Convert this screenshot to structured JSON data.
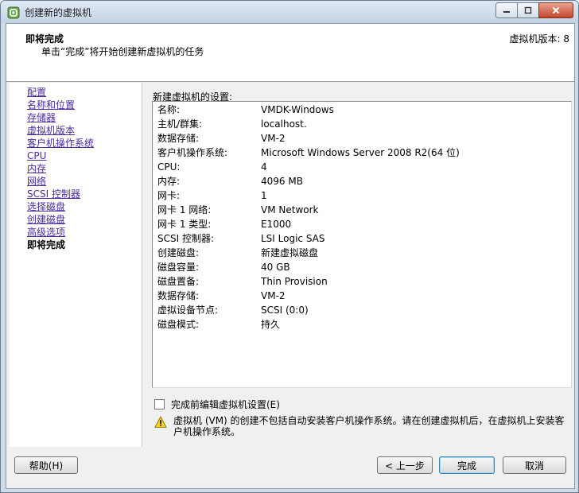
{
  "window": {
    "title": "创建新的虚拟机"
  },
  "header": {
    "title": "即将完成",
    "subtitle": "单击“完成”将开始创建新虚拟机的任务",
    "version": "虚拟机版本: 8"
  },
  "nav": {
    "items": [
      {
        "label": "配置"
      },
      {
        "label": "名称和位置"
      },
      {
        "label": "存储器"
      },
      {
        "label": "虚拟机版本"
      },
      {
        "label": "客户机操作系统"
      },
      {
        "label": "CPU"
      },
      {
        "label": "内存"
      },
      {
        "label": "网络"
      },
      {
        "label": "SCSI 控制器"
      },
      {
        "label": "选择磁盘"
      },
      {
        "label": "创建磁盘"
      },
      {
        "label": "高级选项"
      },
      {
        "label": "即将完成"
      }
    ]
  },
  "settings": {
    "label": "新建虚拟机的设置:",
    "rows": [
      {
        "key": "名称:",
        "value": "VMDK-Windows"
      },
      {
        "key": "主机/群集:",
        "value": "localhost."
      },
      {
        "key": "数据存储:",
        "value": "VM-2"
      },
      {
        "key": "客户机操作系统:",
        "value": "Microsoft Windows Server 2008 R2(64 位)"
      },
      {
        "key": "CPU:",
        "value": "4"
      },
      {
        "key": "内存:",
        "value": "4096 MB"
      },
      {
        "key": "网卡:",
        "value": "1"
      },
      {
        "key": "网卡 1 网络:",
        "value": "VM Network"
      },
      {
        "key": "网卡 1 类型:",
        "value": "E1000"
      },
      {
        "key": "SCSI 控制器:",
        "value": "LSI Logic SAS"
      },
      {
        "key": "创建磁盘:",
        "value": "新建虚拟磁盘"
      },
      {
        "key": "磁盘容量:",
        "value": "40 GB"
      },
      {
        "key": "磁盘置备:",
        "value": "Thin Provision"
      },
      {
        "key": "数据存储:",
        "value": "VM-2"
      },
      {
        "key": "虚拟设备节点:",
        "value": "SCSI (0:0)"
      },
      {
        "key": "磁盘模式:",
        "value": "持久"
      }
    ]
  },
  "edit_checkbox": {
    "label": "完成前编辑虚拟机设置(E)",
    "checked": false
  },
  "warning": {
    "text": "虚拟机 (VM) 的创建不包括自动安装客户机操作系统。请在创建虚拟机后，在虚拟机上安装客户机操作系统。"
  },
  "buttons": {
    "help": "帮助(H)",
    "back": "< 上一步",
    "finish": "完成",
    "cancel": "取消"
  },
  "colors": {
    "link": "#4b2a9c",
    "close_button": "#c4462c"
  }
}
